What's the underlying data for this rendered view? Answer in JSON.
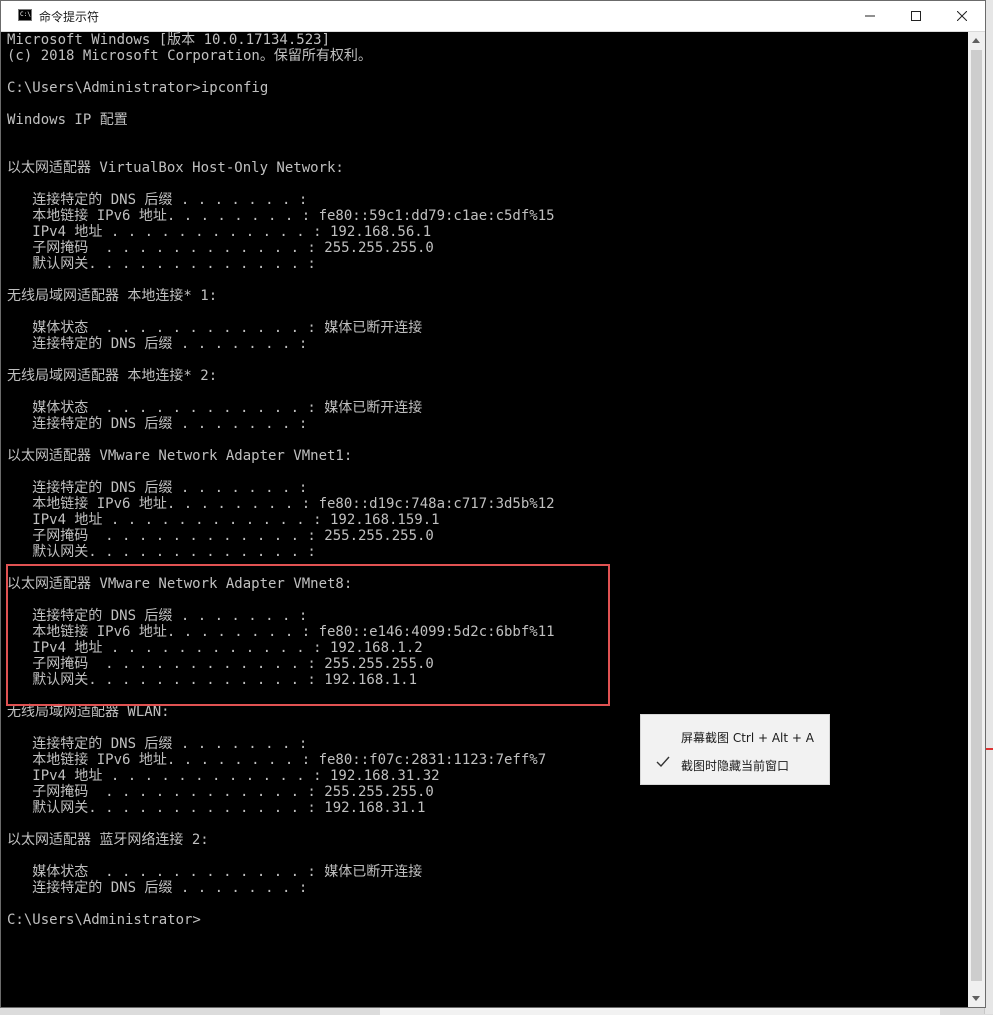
{
  "window": {
    "title": "命令提示符",
    "icon": "command-prompt-icon",
    "controls": [
      "minimize-icon",
      "maximize-icon",
      "close-icon"
    ]
  },
  "console": {
    "lines": [
      "Microsoft Windows [版本 10.0.17134.523]",
      "(c) 2018 Microsoft Corporation。保留所有权利。",
      "",
      "C:\\Users\\Administrator>ipconfig",
      "",
      "Windows IP 配置",
      "",
      "",
      "以太网适配器 VirtualBox Host-Only Network:",
      "",
      "   连接特定的 DNS 后缀 . . . . . . . :",
      "   本地链接 IPv6 地址. . . . . . . . : fe80::59c1:dd79:c1ae:c5df%15",
      "   IPv4 地址 . . . . . . . . . . . . : 192.168.56.1",
      "   子网掩码  . . . . . . . . . . . . : 255.255.255.0",
      "   默认网关. . . . . . . . . . . . . :",
      "",
      "无线局域网适配器 本地连接* 1:",
      "",
      "   媒体状态  . . . . . . . . . . . . : 媒体已断开连接",
      "   连接特定的 DNS 后缀 . . . . . . . :",
      "",
      "无线局域网适配器 本地连接* 2:",
      "",
      "   媒体状态  . . . . . . . . . . . . : 媒体已断开连接",
      "   连接特定的 DNS 后缀 . . . . . . . :",
      "",
      "以太网适配器 VMware Network Adapter VMnet1:",
      "",
      "   连接特定的 DNS 后缀 . . . . . . . :",
      "   本地链接 IPv6 地址. . . . . . . . : fe80::d19c:748a:c717:3d5b%12",
      "   IPv4 地址 . . . . . . . . . . . . : 192.168.159.1",
      "   子网掩码  . . . . . . . . . . . . : 255.255.255.0",
      "   默认网关. . . . . . . . . . . . . :",
      "",
      "以太网适配器 VMware Network Adapter VMnet8:",
      "",
      "   连接特定的 DNS 后缀 . . . . . . . :",
      "   本地链接 IPv6 地址. . . . . . . . : fe80::e146:4099:5d2c:6bbf%11",
      "   IPv4 地址 . . . . . . . . . . . . : 192.168.1.2",
      "   子网掩码  . . . . . . . . . . . . : 255.255.255.0",
      "   默认网关. . . . . . . . . . . . . : 192.168.1.1",
      "",
      "无线局域网适配器 WLAN:",
      "",
      "   连接特定的 DNS 后缀 . . . . . . . :",
      "   本地链接 IPv6 地址. . . . . . . . : fe80::f07c:2831:1123:7eff%7",
      "   IPv4 地址 . . . . . . . . . . . . : 192.168.31.32",
      "   子网掩码  . . . . . . . . . . . . : 255.255.255.0",
      "   默认网关. . . . . . . . . . . . . : 192.168.31.1",
      "",
      "以太网适配器 蓝牙网络连接 2:",
      "",
      "   媒体状态  . . . . . . . . . . . . : 媒体已断开连接",
      "   连接特定的 DNS 后缀 . . . . . . . :",
      "",
      "C:\\Users\\Administrator>"
    ]
  },
  "context_menu": {
    "items": [
      {
        "label": "屏幕截图 Ctrl + Alt + A",
        "checked": false
      },
      {
        "label": "截图时隐藏当前窗口",
        "checked": true
      }
    ]
  },
  "colors": {
    "console_background": "#000000",
    "console_text": "#c0c0c0",
    "highlight_border": "#e05252",
    "title_bar": "#ffffff"
  }
}
